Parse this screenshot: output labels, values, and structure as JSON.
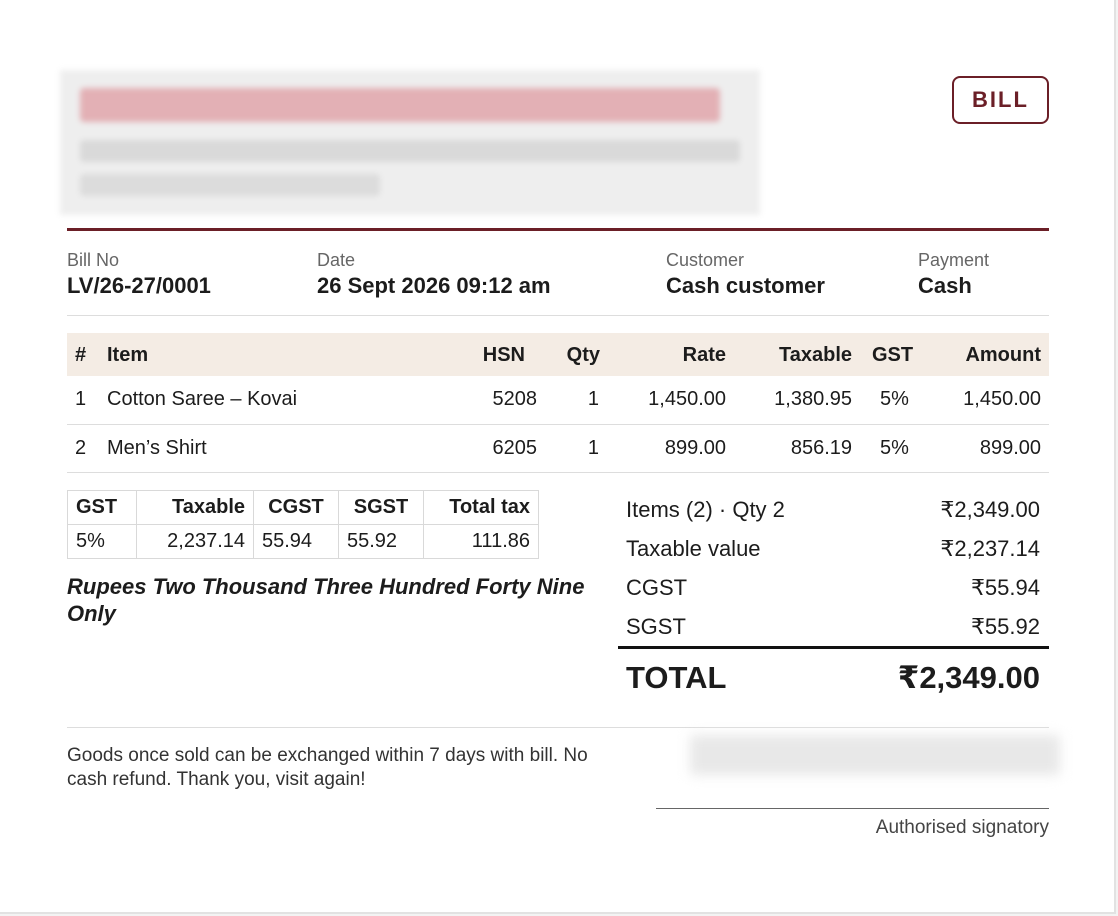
{
  "badge": "BILL",
  "meta": {
    "bill_no_label": "Bill No",
    "bill_no": "LV/26-27/0001",
    "date_label": "Date",
    "date": "26 Sept 2026 09:12 am",
    "customer_label": "Customer",
    "customer": "Cash customer",
    "payment_label": "Payment",
    "payment": "Cash"
  },
  "items": {
    "headers": [
      "#",
      "Item",
      "HSN",
      "Qty",
      "Rate",
      "Taxable",
      "GST",
      "Amount"
    ],
    "rows": [
      {
        "no": "1",
        "item": "Cotton Saree – Kovai",
        "hsn": "5208",
        "qty": "1",
        "rate": "1,450.00",
        "taxable": "1,380.95",
        "gst": "5%",
        "amount": "1,450.00"
      },
      {
        "no": "2",
        "item": "Men’s Shirt",
        "hsn": "6205",
        "qty": "1",
        "rate": "899.00",
        "taxable": "856.19",
        "gst": "5%",
        "amount": "899.00"
      }
    ]
  },
  "gst_summary": {
    "headers": [
      "GST",
      "Taxable",
      "CGST",
      "SGST",
      "Total tax"
    ],
    "rows": [
      [
        "5%",
        "2,237.14",
        "55.94",
        "55.92",
        "111.86"
      ]
    ]
  },
  "amount_in_words": "Rupees Two Thousand Three Hundred Forty Nine Only",
  "summary": [
    {
      "label": "Items (2) · Qty 2",
      "value": "₹2,349.00"
    },
    {
      "label": "Taxable value",
      "value": "₹2,237.14"
    },
    {
      "label": "CGST",
      "value": "₹55.94"
    },
    {
      "label": "SGST",
      "value": "₹55.92"
    }
  ],
  "total": {
    "label": "TOTAL",
    "value": "₹2,349.00"
  },
  "footer_note": "Goods once sold can be exchanged within 7 days with bill. No cash refund. Thank you, visit again!",
  "signature_label": "Authorised signatory",
  "colors": {
    "accent": "#6b1f27",
    "header_bg": "#f4ece4"
  }
}
